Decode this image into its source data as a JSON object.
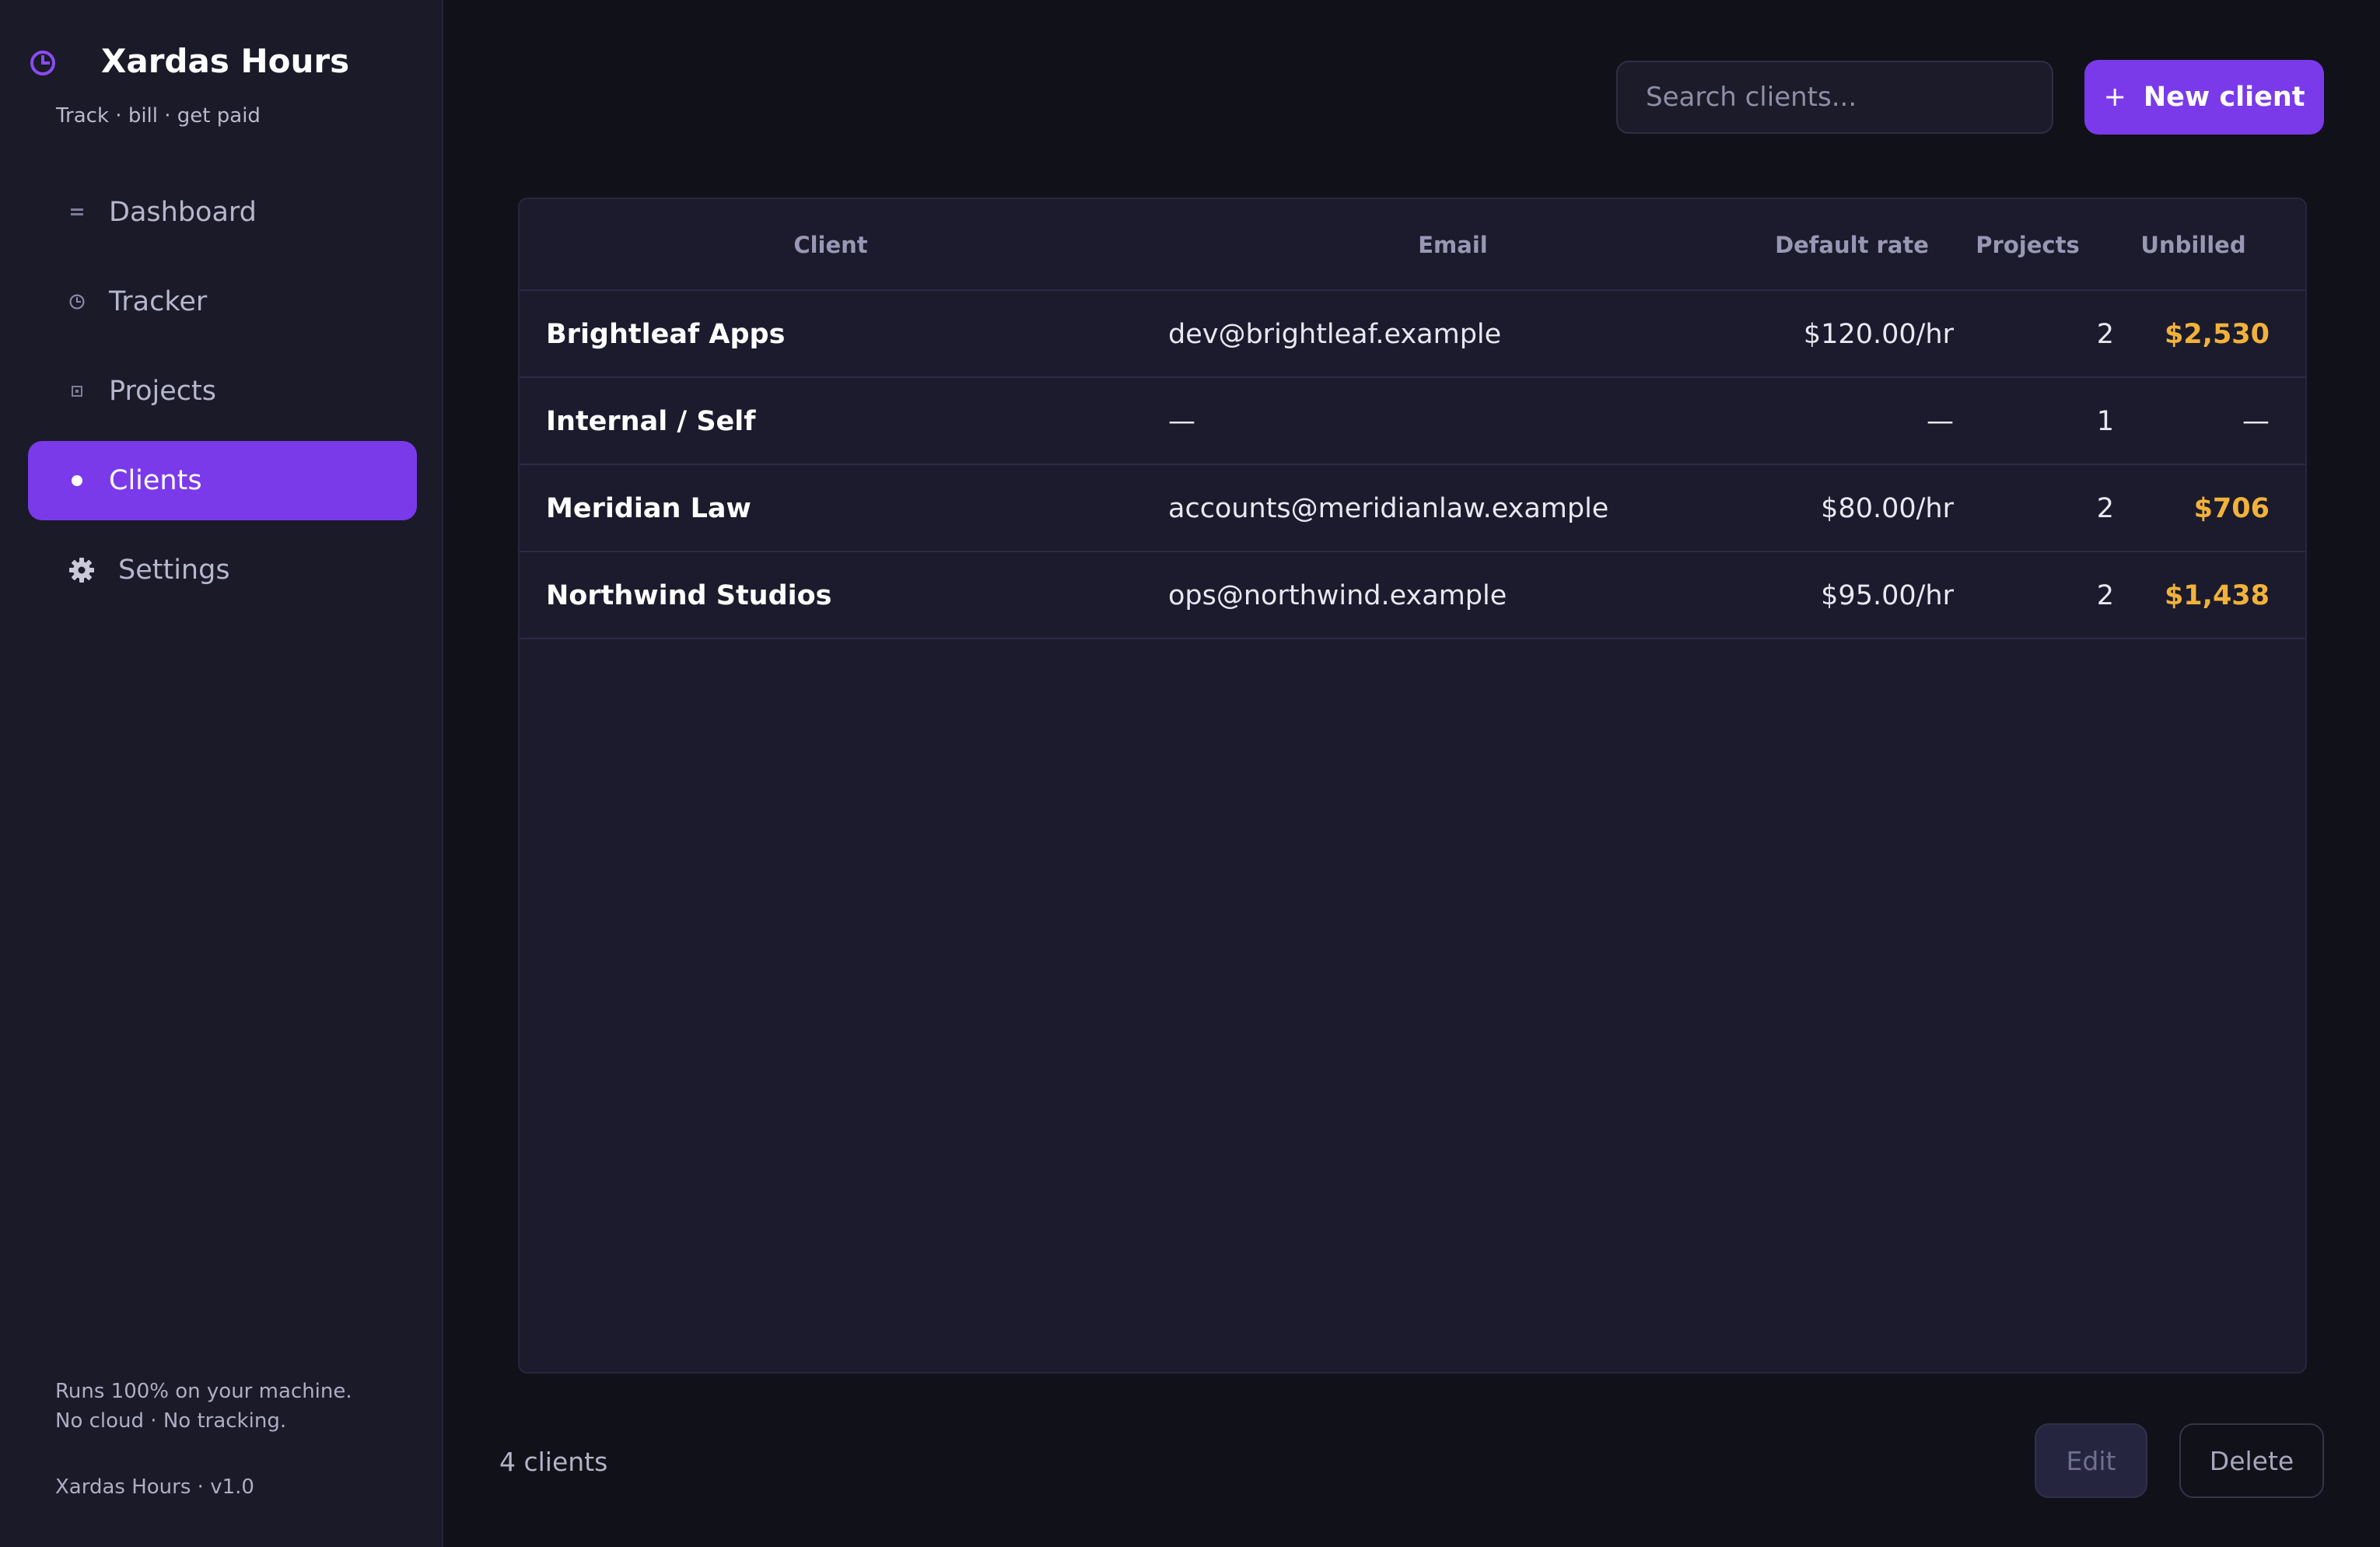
{
  "app": {
    "title": "Xardas Hours",
    "tagline": "Track · bill · get paid",
    "accent_color": "#7a3aea",
    "unbilled_color": "#f2b23a"
  },
  "sidebar": {
    "items": [
      {
        "label": "Dashboard",
        "icon": "dashboard-icon",
        "active": false
      },
      {
        "label": "Tracker",
        "icon": "clock-icon",
        "active": false
      },
      {
        "label": "Projects",
        "icon": "projects-icon",
        "active": false
      },
      {
        "label": "Clients",
        "icon": "dot-icon",
        "active": true
      },
      {
        "label": "Settings",
        "icon": "gear-icon",
        "active": false
      }
    ],
    "footer_note_line1": "Runs 100% on your machine.",
    "footer_note_line2": "No cloud · No tracking.",
    "version": "Xardas Hours · v1.0"
  },
  "toolbar": {
    "search_placeholder": "Search clients...",
    "search_value": "",
    "new_client_plus": "+",
    "new_client_label": "New client"
  },
  "table": {
    "columns": {
      "client": "Client",
      "email": "Email",
      "rate": "Default rate",
      "projects": "Projects",
      "unbilled": "Unbilled"
    },
    "rows": [
      {
        "client": "Brightleaf Apps",
        "email": "dev@brightleaf.example",
        "rate": "$120.00/hr",
        "projects": "2",
        "unbilled": "$2,530"
      },
      {
        "client": "Internal / Self",
        "email": "—",
        "rate": "—",
        "projects": "1",
        "unbilled": "—"
      },
      {
        "client": "Meridian Law",
        "email": "accounts@meridianlaw.example",
        "rate": "$80.00/hr",
        "projects": "2",
        "unbilled": "$706"
      },
      {
        "client": "Northwind Studios",
        "email": "ops@northwind.example",
        "rate": "$95.00/hr",
        "projects": "2",
        "unbilled": "$1,438"
      }
    ]
  },
  "footer": {
    "count": "4 clients",
    "edit_label": "Edit",
    "delete_label": "Delete"
  }
}
